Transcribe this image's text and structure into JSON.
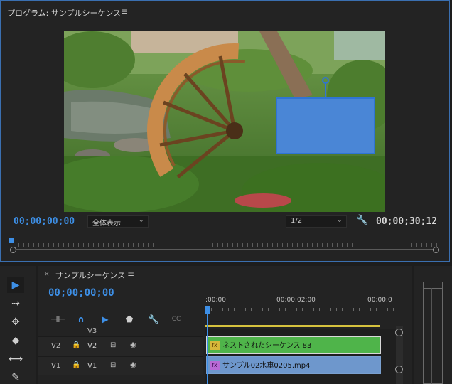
{
  "program_monitor": {
    "title": "プログラム: サンプルシーケンス",
    "menu_icon": "hamburger-icon",
    "timecode_current": "00;00;00;00",
    "timecode_duration": "00;00;30;12",
    "zoom_select": "全体表示",
    "resolution_select": "1/2",
    "settings_icon": "wrench-icon",
    "overlay_shape_color": "#4a86d6"
  },
  "tools": [
    {
      "name": "selection-tool-icon",
      "glyph": "▶",
      "active": true
    },
    {
      "name": "track-select-tool-icon",
      "glyph": "⇢",
      "active": false
    },
    {
      "name": "ripple-edit-tool-icon",
      "glyph": "✥",
      "active": false
    },
    {
      "name": "razor-tool-icon",
      "glyph": "◆",
      "active": false
    },
    {
      "name": "slip-tool-icon",
      "glyph": "⟷",
      "active": false
    },
    {
      "name": "pen-tool-icon",
      "glyph": "✎",
      "active": false
    }
  ],
  "timeline": {
    "close_label": "×",
    "title": "サンプルシーケンス",
    "timecode": "00;00;00;00",
    "ruler_labels": [
      ";00;00",
      "00;00;02;00",
      "00;00;0"
    ],
    "tracks": [
      {
        "src": "",
        "lock": "",
        "name": "V3",
        "sync": "",
        "eye": ""
      },
      {
        "src": "V2",
        "lock": "🔒",
        "name": "V2",
        "sync": "⊟",
        "eye": "◉"
      },
      {
        "src": "V1",
        "lock": "🔒",
        "name": "V1",
        "sync": "⊟",
        "eye": "◉"
      }
    ],
    "clips": {
      "nested": {
        "fx": "fx",
        "label": "ネストされたシーケンス 83",
        "color": "#4fb44a"
      },
      "video": {
        "fx": "fx",
        "label": "サンプル02水車0205.mp4",
        "color": "#6e97cc"
      }
    },
    "toolbar": {
      "insert_icon": "⊣⊢",
      "snap_icon": "∩",
      "linked_icon": "▶",
      "marker_icon": "⬟",
      "wrench_icon": "🔧",
      "captions_icon": "CC"
    }
  },
  "colors": {
    "accent": "#3d8fe6",
    "work_area": "#d6c23e"
  }
}
